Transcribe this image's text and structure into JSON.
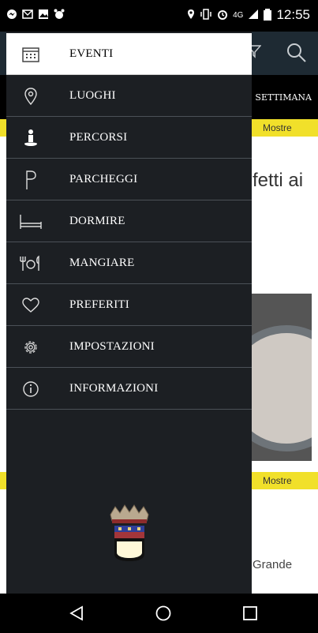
{
  "status_bar": {
    "time": "12:55",
    "network": "4G"
  },
  "background": {
    "tab_label": "SETTIMANA",
    "category_1": "Mostre",
    "title_1": "fetti ai",
    "category_2": "Mostre",
    "title_2": "Grande"
  },
  "drawer": {
    "items": [
      {
        "label": "EVENTI",
        "icon": "calendar-icon",
        "active": true
      },
      {
        "label": "LUOGHI",
        "icon": "location-pin-icon"
      },
      {
        "label": "PERCORSI",
        "icon": "person-route-icon"
      },
      {
        "label": "PARCHEGGI",
        "icon": "parking-icon"
      },
      {
        "label": "DORMIRE",
        "icon": "bed-icon"
      },
      {
        "label": "MANGIARE",
        "icon": "cutlery-icon"
      },
      {
        "label": "PREFERITI",
        "icon": "heart-icon"
      },
      {
        "label": "IMPOSTAZIONI",
        "icon": "gear-icon"
      },
      {
        "label": "INFORMAZIONI",
        "icon": "info-icon"
      }
    ]
  },
  "colors": {
    "drawer_bg": "#1c1f23",
    "accent_yellow": "#f1e02a",
    "topbar": "#1e2a33"
  }
}
